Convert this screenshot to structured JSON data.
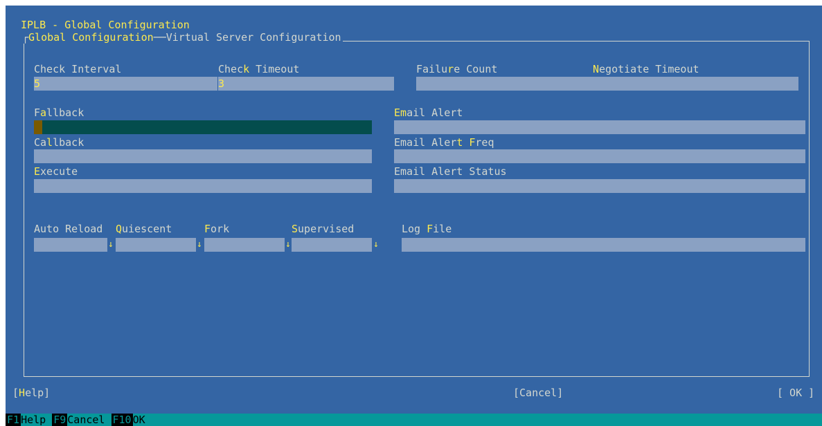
{
  "window": {
    "title": "IPLB - Global Configuration"
  },
  "tabs": [
    {
      "label": "Global Configuration",
      "active": true
    },
    {
      "label": "Virtual Server Configuration",
      "active": false
    }
  ],
  "fields": {
    "check_interval": {
      "label_a": "Check Interval",
      "value": "5"
    },
    "check_timeout": {
      "label_a": "Chec",
      "hotkey": "k",
      "label_b": " Timeout",
      "value": "3"
    },
    "failure_count": {
      "label_a": "Failu",
      "hotkey": "r",
      "label_b": "e Count",
      "value": ""
    },
    "negotiate_timeout": {
      "label_a": "",
      "hotkey": "N",
      "label_b": "egotiate Timeout",
      "value": ""
    },
    "fallback": {
      "label_a": "F",
      "hotkey": "a",
      "label_b": "llback",
      "value": ""
    },
    "callback": {
      "label_a": "Ca",
      "hotkey": "l",
      "label_b": "lback",
      "value": ""
    },
    "execute": {
      "label_a": "",
      "hotkey": "E",
      "label_b": "xecute",
      "value": ""
    },
    "email_alert": {
      "label_a": "",
      "hotkey": "Em",
      "label_b": "ail Alert",
      "value": ""
    },
    "email_alert_freq": {
      "label_a": "Email Aler",
      "hotkey": "t",
      "label_b": " ",
      "hotkey2": "F",
      "label_c": "req",
      "value": ""
    },
    "email_alert_status": {
      "label_a": "Email Alert Status",
      "value": ""
    },
    "auto_reload": {
      "label_a": "Auto Reload",
      "value": ""
    },
    "quiescent": {
      "label_a": "",
      "hotkey": "Q",
      "label_b": "uiescent",
      "value": ""
    },
    "fork": {
      "label_a": "",
      "hotkey": "F",
      "label_b": "ork",
      "value": ""
    },
    "supervised": {
      "label_a": "",
      "hotkey": "S",
      "label_b": "upervised",
      "value": ""
    },
    "log_file": {
      "label_a": "Log ",
      "hotkey": "F",
      "label_b": "ile",
      "value": ""
    }
  },
  "dropdown_arrow": "↓",
  "buttons": {
    "help": {
      "open": "[",
      "hotkey": "H",
      "rest": "elp]"
    },
    "cancel": {
      "label": "[Cancel]"
    },
    "ok": {
      "label": "[ OK ]"
    }
  },
  "statusbar": [
    {
      "key": "F1",
      "label": "Help"
    },
    {
      "key": "F9",
      "label": "Cancel"
    },
    {
      "key": "F10",
      "label": "OK"
    }
  ],
  "colors": {
    "background": "#3465a4",
    "field": "#8aa1c3",
    "active_field": "#044d4d",
    "highlight": "#fce94f",
    "statusbar": "#06989a"
  }
}
